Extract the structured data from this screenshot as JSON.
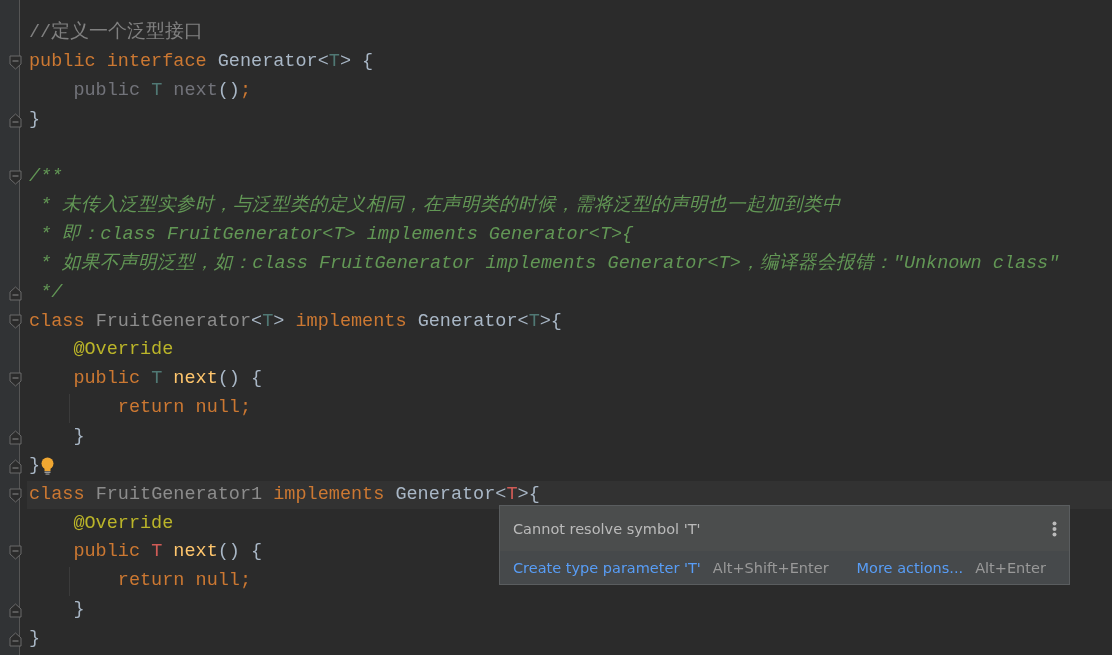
{
  "editor": {
    "lines": [
      {
        "kind": "code",
        "tokens": [
          {
            "kind": "comment",
            "text": "//定义一个泛型接口"
          }
        ]
      },
      {
        "kind": "code",
        "fold_start": true,
        "tokens": [
          {
            "kind": "keyword",
            "text": "public interface "
          },
          {
            "kind": "plain",
            "text": "Generator<"
          },
          {
            "kind": "typeparam",
            "text": "T"
          },
          {
            "kind": "plain",
            "text": "> {"
          }
        ]
      },
      {
        "kind": "code",
        "tokens": [
          {
            "kind": "unused",
            "text": "    public "
          },
          {
            "kind": "typeparam",
            "text": "T"
          },
          {
            "kind": "unused",
            "text": " next"
          },
          {
            "kind": "plain",
            "text": "()"
          },
          {
            "kind": "keyword",
            "text": ";"
          }
        ]
      },
      {
        "kind": "code",
        "fold_end": true,
        "tokens": [
          {
            "kind": "plain",
            "text": "}"
          }
        ]
      },
      {
        "kind": "blank"
      },
      {
        "kind": "code",
        "fold_start": true,
        "tokens": [
          {
            "kind": "doc",
            "text": "/**"
          }
        ]
      },
      {
        "kind": "code",
        "tokens": [
          {
            "kind": "doc",
            "text": " * 未传入泛型实参时，与泛型类的定义相同，在声明类的时候，需将泛型的声明也一起加到类中"
          }
        ]
      },
      {
        "kind": "code",
        "tokens": [
          {
            "kind": "doc",
            "text": " * 即：class FruitGenerator<T> implements Generator<T>{"
          }
        ]
      },
      {
        "kind": "code",
        "tokens": [
          {
            "kind": "doc",
            "text": " * 如果不声明泛型，如：class FruitGenerator implements Generator<T>，编译器会报错：\"Unknown class\""
          }
        ]
      },
      {
        "kind": "code",
        "fold_end": true,
        "tokens": [
          {
            "kind": "doc",
            "text": " */"
          }
        ]
      },
      {
        "kind": "code",
        "fold_start": true,
        "tokens": [
          {
            "kind": "keyword",
            "text": "class "
          },
          {
            "kind": "unusedclass",
            "text": "FruitGenerator"
          },
          {
            "kind": "plain",
            "text": "<"
          },
          {
            "kind": "typeparam",
            "text": "T"
          },
          {
            "kind": "plain",
            "text": "> "
          },
          {
            "kind": "keyword",
            "text": "implements "
          },
          {
            "kind": "plain",
            "text": "Generator<"
          },
          {
            "kind": "typeparam",
            "text": "T"
          },
          {
            "kind": "plain",
            "text": ">{"
          }
        ]
      },
      {
        "kind": "code",
        "tokens": [
          {
            "kind": "annotation",
            "text": "    @Override"
          }
        ]
      },
      {
        "kind": "code",
        "fold_start": true,
        "tokens": [
          {
            "kind": "keyword",
            "text": "    public "
          },
          {
            "kind": "typeparam",
            "text": "T "
          },
          {
            "kind": "method",
            "text": "next"
          },
          {
            "kind": "plain",
            "text": "() {"
          }
        ]
      },
      {
        "kind": "code",
        "guide": true,
        "tokens": [
          {
            "kind": "keyword",
            "text": "        return null;"
          }
        ]
      },
      {
        "kind": "code",
        "fold_end": true,
        "tokens": [
          {
            "kind": "plain",
            "text": "    }"
          }
        ]
      },
      {
        "kind": "code",
        "fold_end": true,
        "bulb": true,
        "tokens": [
          {
            "kind": "plain",
            "text": "}"
          }
        ]
      },
      {
        "kind": "code",
        "fold_start": true,
        "current": true,
        "tokens": [
          {
            "kind": "keyword",
            "text": "class "
          },
          {
            "kind": "unusedclass",
            "text": "FruitGenerator1 "
          },
          {
            "kind": "keyword",
            "text": "implements "
          },
          {
            "kind": "plain",
            "text": "Generator<"
          },
          {
            "kind": "error",
            "text": "T"
          },
          {
            "kind": "plain",
            "text": ">{"
          }
        ]
      },
      {
        "kind": "code",
        "tokens": [
          {
            "kind": "annotation",
            "text": "    @Override"
          }
        ]
      },
      {
        "kind": "code",
        "fold_start": true,
        "tokens": [
          {
            "kind": "keyword",
            "text": "    public "
          },
          {
            "kind": "error",
            "text": "T "
          },
          {
            "kind": "method",
            "text": "next"
          },
          {
            "kind": "plain",
            "text": "() {"
          }
        ]
      },
      {
        "kind": "code",
        "guide": true,
        "tokens": [
          {
            "kind": "keyword",
            "text": "        return null;"
          }
        ]
      },
      {
        "kind": "code",
        "fold_end": true,
        "tokens": [
          {
            "kind": "plain",
            "text": "    }"
          }
        ]
      },
      {
        "kind": "code",
        "fold_end": true,
        "tokens": [
          {
            "kind": "plain",
            "text": "}"
          }
        ]
      }
    ]
  },
  "popup": {
    "message": "Cannot resolve symbol 'T'",
    "actions": [
      {
        "label": "Create type parameter 'T'",
        "shortcut": "Alt+Shift+Enter"
      },
      {
        "label": "More actions...",
        "shortcut": "Alt+Enter"
      }
    ]
  }
}
